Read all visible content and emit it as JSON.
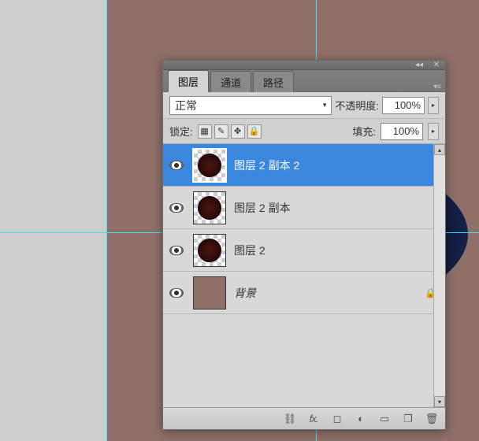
{
  "tabs": {
    "layers": "图层",
    "channels": "通道",
    "paths": "路径"
  },
  "options": {
    "blend_mode": "正常",
    "opacity_label": "不透明度:",
    "opacity_value": "100%",
    "lock_label": "锁定:",
    "fill_label": "填充:",
    "fill_value": "100%"
  },
  "layers": [
    {
      "name": "图层 2 副本 2",
      "visible": true,
      "selected": true,
      "thumb": "circle-trans",
      "locked": false
    },
    {
      "name": "图层 2 副本",
      "visible": true,
      "selected": false,
      "thumb": "circle-trans",
      "locked": false
    },
    {
      "name": "图层 2",
      "visible": true,
      "selected": false,
      "thumb": "circle-trans",
      "locked": false
    },
    {
      "name": "背景",
      "visible": true,
      "selected": false,
      "thumb": "solid",
      "locked": true
    }
  ],
  "footer_icons": {
    "link": "⛓",
    "fx": "fx.",
    "mask": "◻",
    "adjust": "◐",
    "group": "▭",
    "new": "❐",
    "trash": "🗑"
  }
}
